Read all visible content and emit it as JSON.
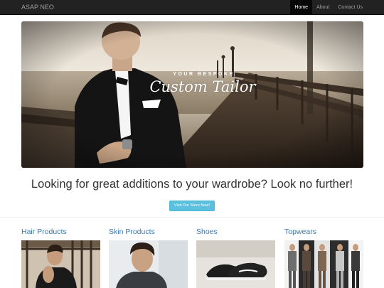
{
  "navbar": {
    "brand": "ASAP NEO",
    "items": [
      {
        "label": "Home",
        "active": true
      },
      {
        "label": "About",
        "active": false
      },
      {
        "label": "Contact Us",
        "active": false
      }
    ]
  },
  "hero": {
    "tagline_top": "YOUR BESPOKE",
    "tagline_script": "Custom Tailor"
  },
  "headline": "Looking for great additions to your wardrobe? Look no further!",
  "cta_label": "Visit Our Store Now!",
  "categories": [
    {
      "title": "Hair Products"
    },
    {
      "title": "Skin Products"
    },
    {
      "title": "Shoes"
    },
    {
      "title": "Topwears"
    }
  ],
  "colors": {
    "navbar": "#222222",
    "link": "#337ab7",
    "cta": "#5bc0de"
  }
}
